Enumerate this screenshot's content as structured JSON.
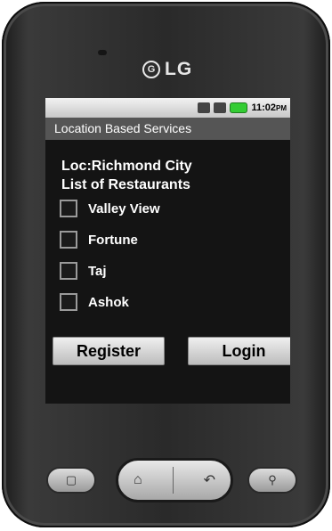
{
  "device": {
    "brand": "LG",
    "logo_mark": "G"
  },
  "statusbar": {
    "time": "11:02",
    "ampm": "PM"
  },
  "app": {
    "title": "Location Based Services"
  },
  "content": {
    "location_label": "Loc:Richmond City",
    "list_title": "List of Restaurants",
    "restaurants": [
      {
        "label": "Valley View",
        "checked": false
      },
      {
        "label": "Fortune",
        "checked": false
      },
      {
        "label": "Taj",
        "checked": false
      },
      {
        "label": "Ashok",
        "checked": false
      }
    ]
  },
  "buttons": {
    "register": "Register",
    "login": "Login"
  },
  "hardware": {
    "menu_icon": "menu-icon",
    "home_icon": "home-icon",
    "back_icon": "back-icon",
    "search_icon": "search-icon"
  },
  "colors": {
    "titlebar": "#555555",
    "battery": "#33cc33",
    "background": "#141414"
  }
}
